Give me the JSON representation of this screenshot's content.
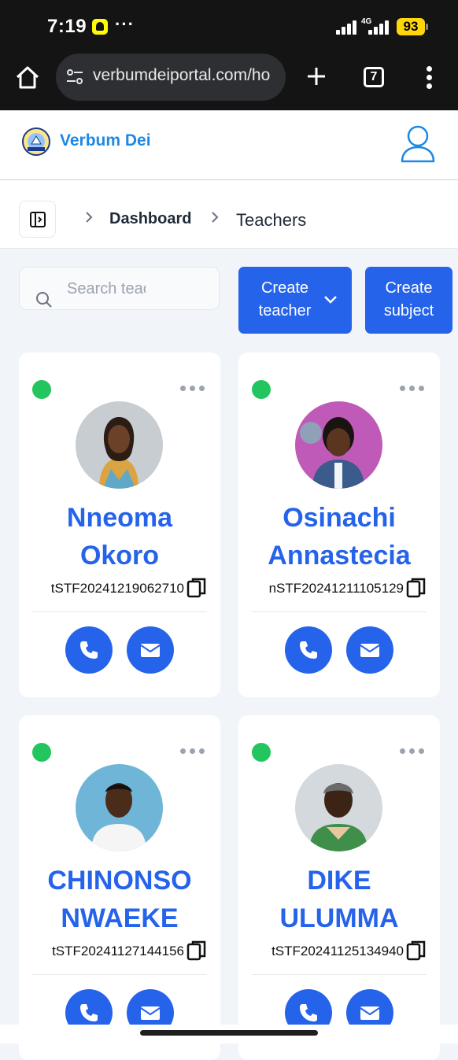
{
  "status_bar": {
    "time": "7:19",
    "dots": "···",
    "network": "4G",
    "battery": "93"
  },
  "browser": {
    "url": "verbumdeiportal.com/ho",
    "tab_count": "7"
  },
  "site": {
    "brand": "Verbum Dei"
  },
  "breadcrumb": {
    "dashboard": "Dashboard",
    "current": "Teachers"
  },
  "toolbar": {
    "search_placeholder": "Search teachers",
    "create_teacher_line1": "Create",
    "create_teacher_line2": "teacher",
    "create_subject_line1": "Create",
    "create_subject_line2": "subject"
  },
  "teachers": [
    {
      "first": "Nneoma",
      "last": "Okoro",
      "id": "tSTF20241219062710"
    },
    {
      "first": "Osinachi",
      "last": "Annastecia",
      "id": "nSTF20241211105129"
    },
    {
      "first": "CHINONSO",
      "last": "NWAEKE",
      "id": "tSTF20241127144156"
    },
    {
      "first": "DIKE",
      "last": "ULUMMA",
      "id": "tSTF20241125134940"
    }
  ],
  "colors": {
    "primary": "#2563eb",
    "online": "#22c55e",
    "brand": "#1e88e5"
  }
}
